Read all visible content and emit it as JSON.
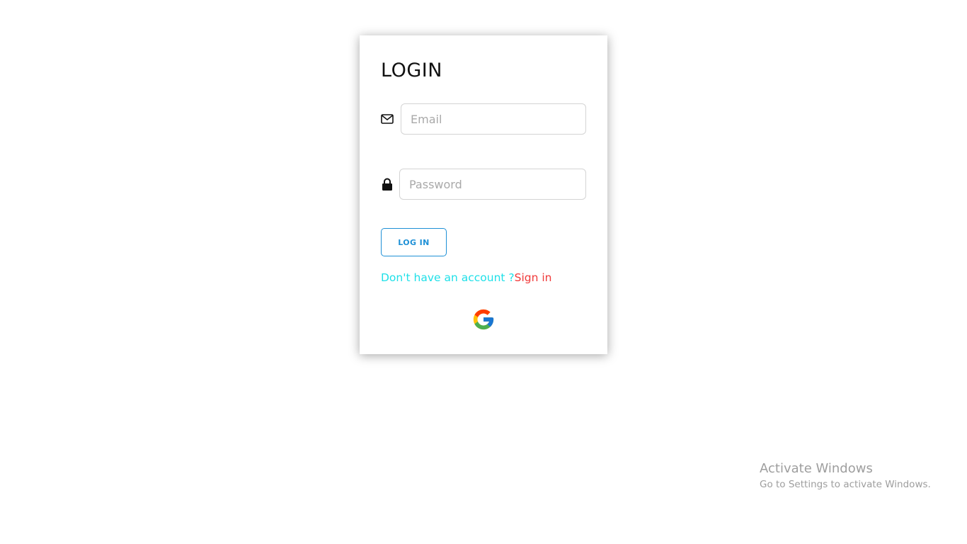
{
  "login_card": {
    "title": "LOGIN",
    "email": {
      "placeholder": "Email",
      "value": "",
      "icon": "envelope-icon"
    },
    "password": {
      "placeholder": "Password",
      "value": "",
      "icon": "lock-icon"
    },
    "login_button_label": "LOG IN",
    "signup_prompt": "Don't have an account ?",
    "signin_link": "Sign in",
    "google_icon": "google-icon"
  },
  "watermark": {
    "title": "Activate Windows",
    "subtitle": "Go to Settings to activate Windows."
  },
  "colors": {
    "button_accent": "#1e90d6",
    "prompt_text": "#1fe0e8",
    "link_text": "#f03a3a",
    "input_border": "#d4d4d4"
  }
}
